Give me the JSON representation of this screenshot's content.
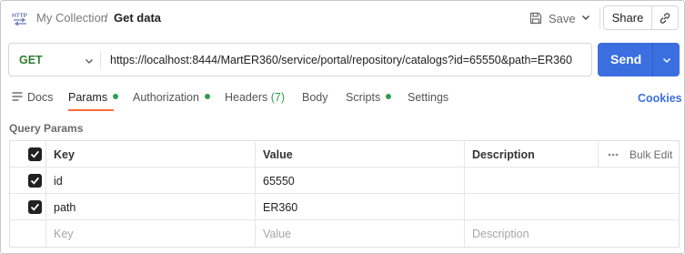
{
  "header": {
    "icon": "http-icon",
    "breadcrumb_parent": "My Collection",
    "breadcrumb_separator": "/",
    "title": "Get data",
    "save_label": "Save",
    "share_label": "Share"
  },
  "request": {
    "method": "GET",
    "url": "https://localhost:8444/MartER360/service/portal/repository/catalogs?id=65550&path=ER360",
    "send_label": "Send"
  },
  "tabs": [
    {
      "label": "Docs",
      "icon": "docs-icon"
    },
    {
      "label": "Params",
      "dot": true,
      "active": true
    },
    {
      "label": "Authorization",
      "dot": true
    },
    {
      "label": "Headers",
      "count": "(7)"
    },
    {
      "label": "Body"
    },
    {
      "label": "Scripts",
      "dot": true
    },
    {
      "label": "Settings"
    }
  ],
  "cookies_label": "Cookies",
  "query_params": {
    "title": "Query Params",
    "columns": {
      "key": "Key",
      "value": "Value",
      "description": "Description"
    },
    "bulk_edit_label": "Bulk Edit",
    "rows": [
      {
        "checked": true,
        "key": "id",
        "value": "65550",
        "description": ""
      },
      {
        "checked": true,
        "key": "path",
        "value": "ER360",
        "description": ""
      }
    ],
    "placeholder": {
      "key": "Key",
      "value": "Value",
      "description": "Description"
    }
  },
  "colors": {
    "accent_blue": "#3b6fe0",
    "method_green": "#2f7d32",
    "status_dot_green": "#2e9e4f",
    "active_tab_orange": "#ff6c37"
  }
}
